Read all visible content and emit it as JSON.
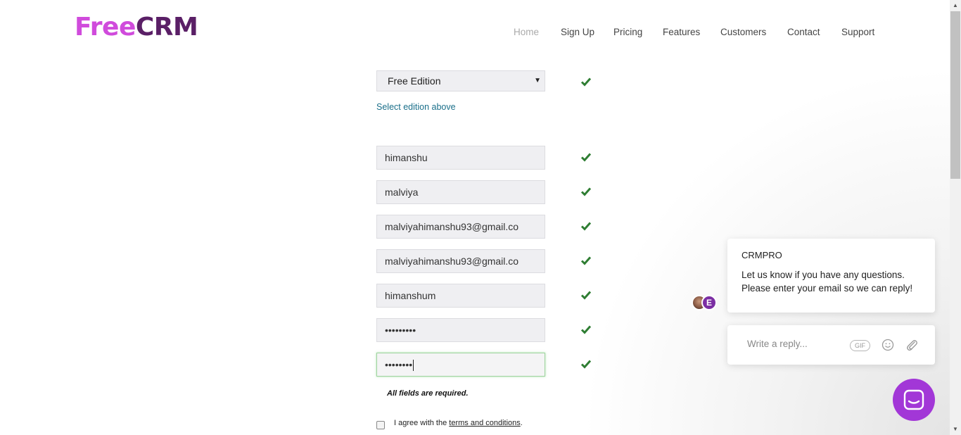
{
  "brand": {
    "free": "Free",
    "crm": "CRM"
  },
  "nav": [
    {
      "label": "Home",
      "active": true
    },
    {
      "label": "Sign Up"
    },
    {
      "label": "Pricing"
    },
    {
      "label": "Features"
    },
    {
      "label": "Customers"
    },
    {
      "label": "Contact"
    },
    {
      "label": "Support"
    }
  ],
  "form": {
    "edition": "Free Edition",
    "edition_hint": "Select edition above",
    "first_name": "himanshu",
    "last_name": "malviya",
    "email": "malviyahimanshu93@gmail.co",
    "email_confirm": "malviyahimanshu93@gmail.co",
    "username": "himanshum",
    "password": "•••••••••",
    "password_confirm": "••••••••",
    "required_note": "All fields are required.",
    "agree_prefix": "I agree with the ",
    "agree_link": "terms and conditions",
    "agree_suffix": "."
  },
  "chat": {
    "title": "CRMPRO",
    "message_line1": "Let us know if you have any questions.",
    "message_line2": "Please enter your email so we can reply!",
    "avatar_letter": "E",
    "reply_placeholder": "Write a reply...",
    "gif_label": "GIF"
  },
  "icons": {
    "check": "check-icon",
    "emoji": "smiley-icon",
    "attach": "paperclip-icon",
    "launcher": "chat-bubble-icon"
  },
  "colors": {
    "brand_free": "#d04bdc",
    "brand_crm": "#5a1f66",
    "check_green": "#2e7d32",
    "launcher": "#a237d7"
  }
}
